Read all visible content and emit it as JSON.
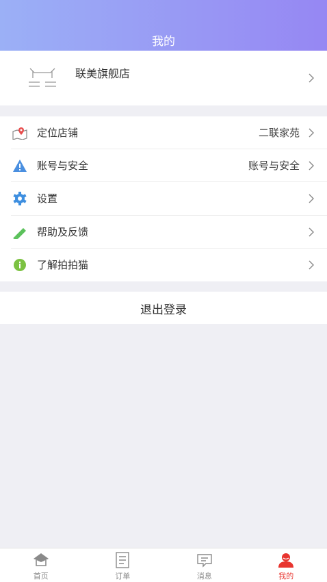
{
  "header": {
    "title": "我的"
  },
  "profile": {
    "store_name": "联美旗舰店",
    "logo_icon": "store-logo-icon"
  },
  "menu": {
    "items": [
      {
        "label": "定位店铺",
        "value": "二联家苑",
        "icon": "map-pin-icon",
        "icon_color": "#e84d4d"
      },
      {
        "label": "账号与安全",
        "value": "账号与安全",
        "icon": "warning-icon",
        "icon_color": "#4a8fe0"
      },
      {
        "label": "设置",
        "value": "",
        "icon": "gear-icon",
        "icon_color": "#3e8fe0"
      },
      {
        "label": "帮助及反馈",
        "value": "",
        "icon": "pencil-icon",
        "icon_color": "#5bc15b"
      },
      {
        "label": "了解拍拍猫",
        "value": "",
        "icon": "info-icon",
        "icon_color": "#7cc242"
      }
    ]
  },
  "logout": {
    "label": "退出登录"
  },
  "tabbar": {
    "items": [
      {
        "label": "首页",
        "icon": "home-icon",
        "active": false
      },
      {
        "label": "订单",
        "icon": "order-icon",
        "active": false
      },
      {
        "label": "消息",
        "icon": "message-icon",
        "active": false
      },
      {
        "label": "我的",
        "icon": "profile-icon",
        "active": true
      }
    ],
    "active_color": "#e8352f"
  }
}
